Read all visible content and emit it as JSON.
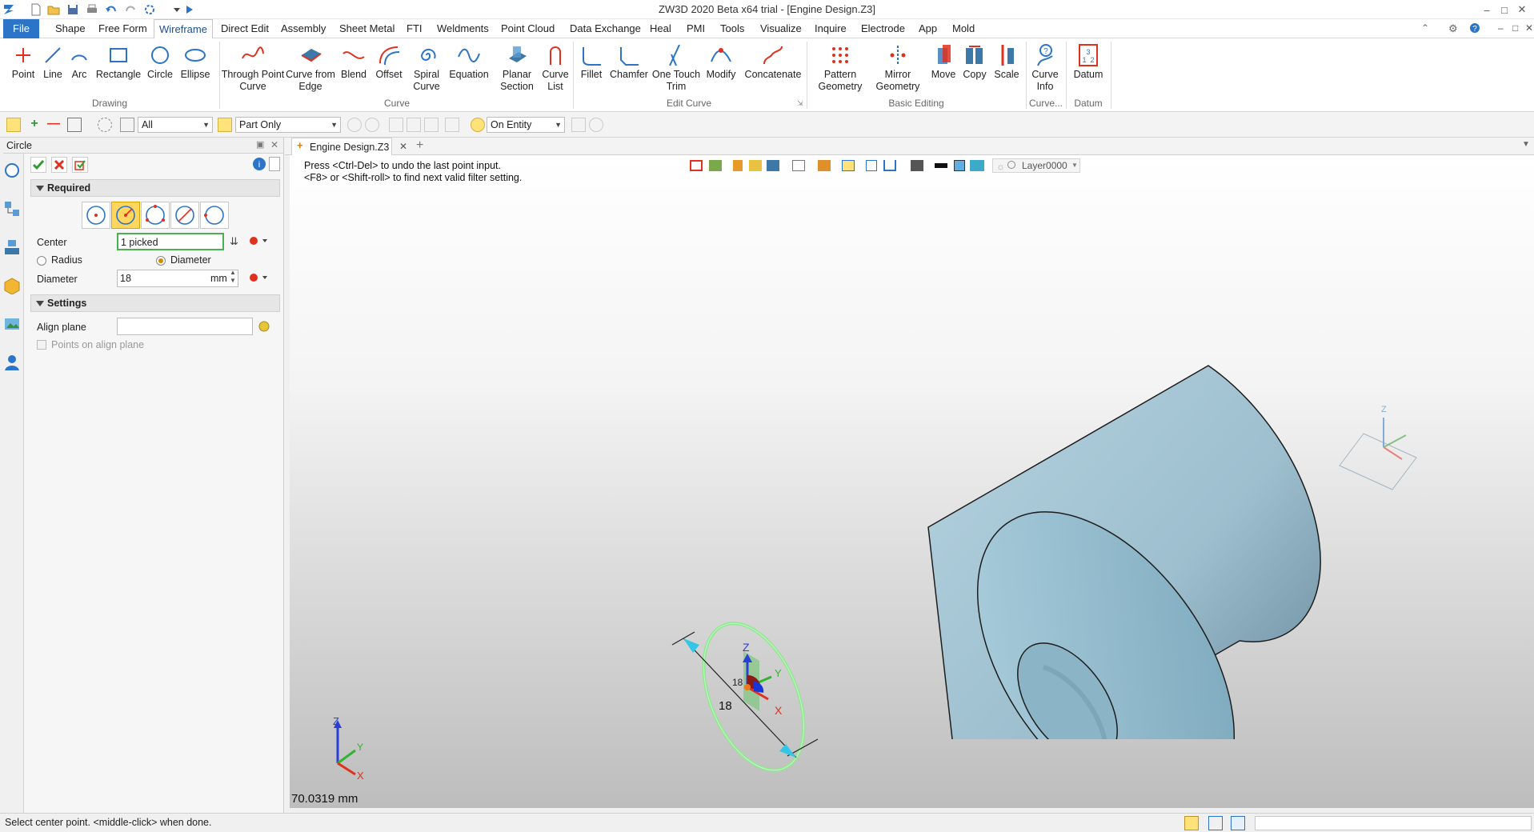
{
  "window": {
    "title": "ZW3D 2020 Beta x64 trial - [Engine Design.Z3]"
  },
  "icons": {
    "quick_access": [
      "app-logo-icon",
      "new-file-icon",
      "open-file-icon",
      "save-icon",
      "print-icon",
      "undo-icon",
      "redo-icon",
      "refresh-icon",
      "customize-icon",
      "run-icon"
    ],
    "accent": "#2b74c7",
    "circle_preview": "#7fdc7f",
    "model_color": "#9fc3d3"
  },
  "menu": {
    "tabs": [
      "File",
      "Shape",
      "Free Form",
      "Wireframe",
      "Direct Edit",
      "Assembly",
      "Sheet Metal",
      "FTI",
      "Weldments",
      "Point Cloud",
      "Data Exchange",
      "Heal",
      "PMI",
      "Tools",
      "Visualize",
      "Inquire",
      "Electrode",
      "App",
      "Mold"
    ],
    "active": "Wireframe"
  },
  "ribbon": {
    "buttons": [
      {
        "label": "Point",
        "icon": "point-icon"
      },
      {
        "label": "Line",
        "icon": "line-icon"
      },
      {
        "label": "Arc",
        "icon": "arc-icon"
      },
      {
        "label": "Rectangle",
        "icon": "rectangle-icon"
      },
      {
        "label": "Circle",
        "icon": "circle-icon"
      },
      {
        "label": "Ellipse",
        "icon": "ellipse-icon"
      },
      {
        "label": "Through Point\nCurve",
        "icon": "through-point-curve-icon"
      },
      {
        "label": "Curve from\nEdge",
        "icon": "curve-from-edge-icon"
      },
      {
        "label": "Blend",
        "icon": "blend-icon"
      },
      {
        "label": "Offset",
        "icon": "offset-icon"
      },
      {
        "label": "Spiral\nCurve",
        "icon": "spiral-curve-icon"
      },
      {
        "label": "Equation",
        "icon": "equation-icon"
      },
      {
        "label": "Planar\nSection",
        "icon": "planar-section-icon"
      },
      {
        "label": "Curve\nList",
        "icon": "curve-list-icon"
      },
      {
        "label": "Fillet",
        "icon": "fillet-icon"
      },
      {
        "label": "Chamfer",
        "icon": "chamfer-icon"
      },
      {
        "label": "One Touch\nTrim",
        "icon": "one-touch-trim-icon"
      },
      {
        "label": "Modify",
        "icon": "modify-icon"
      },
      {
        "label": "Concatenate",
        "icon": "concatenate-icon"
      },
      {
        "label": "Pattern\nGeometry",
        "icon": "pattern-geometry-icon"
      },
      {
        "label": "Mirror\nGeometry",
        "icon": "mirror-geometry-icon"
      },
      {
        "label": "Move",
        "icon": "move-icon"
      },
      {
        "label": "Copy",
        "icon": "copy-icon"
      },
      {
        "label": "Scale",
        "icon": "scale-icon"
      },
      {
        "label": "Curve\nInfo",
        "icon": "curve-info-icon"
      },
      {
        "label": "Datum",
        "icon": "datum-icon"
      }
    ],
    "groups": [
      "Drawing",
      "Curve",
      "Edit Curve",
      "Basic Editing",
      "Curve...",
      "Datum"
    ]
  },
  "filterbar": {
    "filter": "All",
    "scope": "Part Only",
    "snap": "On Entity"
  },
  "panel": {
    "title": "Circle",
    "required": "Required",
    "center_label": "Center",
    "center_value": "1 picked",
    "radius_label": "Radius",
    "diameter_option": "Diameter",
    "selected_mode": "Diameter",
    "diameter_label": "Diameter",
    "diameter_value": "18",
    "unit": "mm",
    "settings": "Settings",
    "align_plane_label": "Align plane",
    "align_plane_value": "",
    "points_on_align": "Points on align plane"
  },
  "doc": {
    "tab": "Engine Design.Z3"
  },
  "viewport": {
    "prompt1": "Press <Ctrl-Del> to undo the last point input.",
    "prompt2": "<F8> or <Shift-roll> to find next valid filter setting.",
    "layer": "Layer0000",
    "dimension_value": "18",
    "dimension_value_small": "18",
    "triad_labels": {
      "z": "Z",
      "y": "Y",
      "x": "X"
    },
    "distance": "70.0319 mm"
  },
  "status": {
    "text": "Select center point.  <middle-click> when done."
  }
}
